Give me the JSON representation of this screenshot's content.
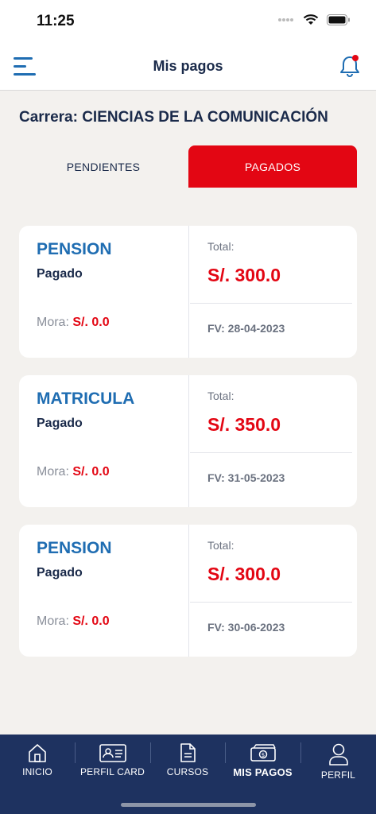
{
  "status_bar": {
    "time": "11:25"
  },
  "header": {
    "title": "Mis pagos"
  },
  "career_label": "Carrera: CIENCIAS DE LA COMUNICACIÓN",
  "tabs": [
    {
      "label": "PENDIENTES",
      "active": false
    },
    {
      "label": "PAGADOS",
      "active": true
    }
  ],
  "payments": [
    {
      "type": "PENSION",
      "status": "Pagado",
      "mora_label": "Mora:",
      "mora_value": "S/. 0.0",
      "total_label": "Total:",
      "total_value": "S/. 300.0",
      "fv": "FV: 28-04-2023"
    },
    {
      "type": "MATRICULA",
      "status": "Pagado",
      "mora_label": "Mora:",
      "mora_value": "S/. 0.0",
      "total_label": "Total:",
      "total_value": "S/. 350.0",
      "fv": "FV: 31-05-2023"
    },
    {
      "type": "PENSION",
      "status": "Pagado",
      "mora_label": "Mora:",
      "mora_value": "S/. 0.0",
      "total_label": "Total:",
      "total_value": "S/. 300.0",
      "fv": "FV: 30-06-2023"
    }
  ],
  "bottom_nav": [
    {
      "label": "INICIO",
      "icon": "home-icon"
    },
    {
      "label": "PERFIL CARD",
      "icon": "id-card-icon"
    },
    {
      "label": "CURSOS",
      "icon": "document-icon"
    },
    {
      "label": "MIS PAGOS",
      "icon": "money-icon",
      "active": true
    },
    {
      "label": "PERFIL",
      "icon": "user-icon"
    }
  ],
  "colors": {
    "accent_red": "#e30613",
    "brand_blue": "#1f6db2",
    "nav_bg": "#1e3260",
    "text_dark": "#1a2a4a"
  }
}
